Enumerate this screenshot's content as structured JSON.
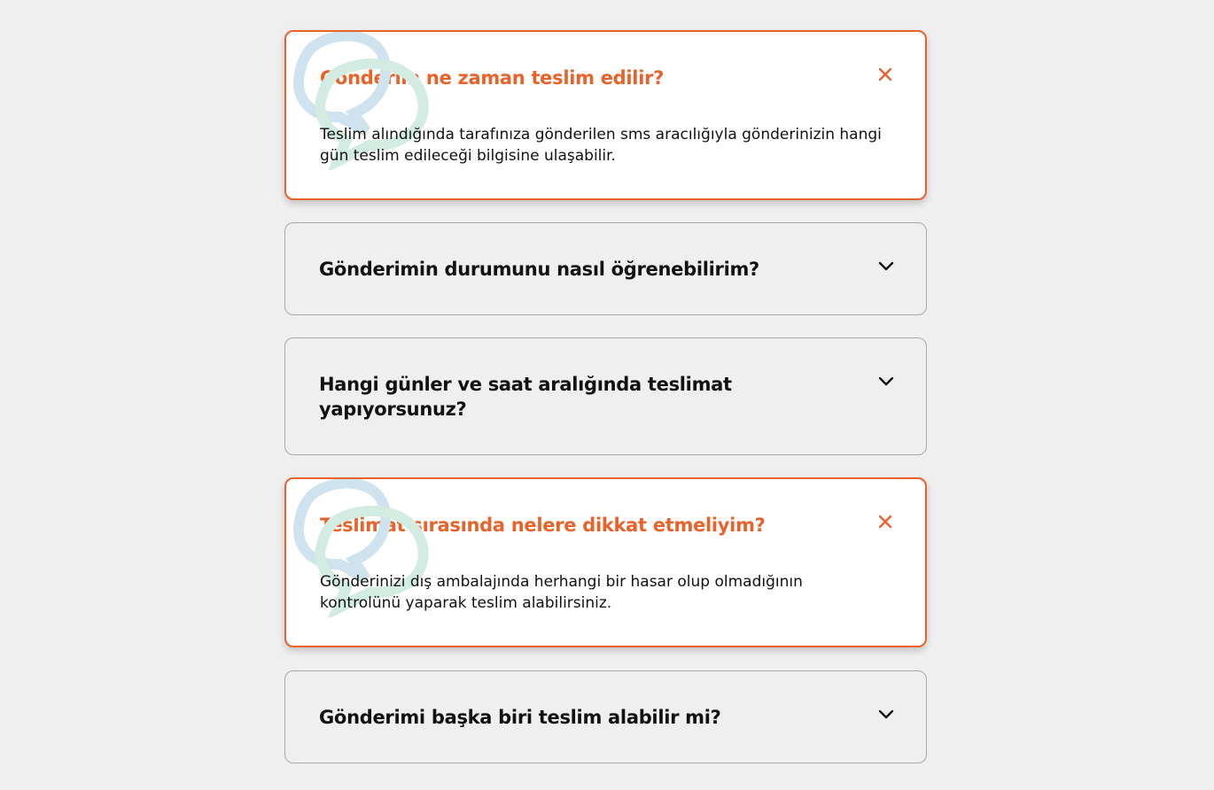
{
  "colors": {
    "accent": "#e8622a",
    "page_background": "#efefef",
    "card_open_background": "#ffffff",
    "card_border": "#a9a9a9",
    "text": "#111111",
    "deco_blue": "#cfe3ef",
    "deco_green": "#d3ece2"
  },
  "faq": {
    "items": [
      {
        "question": "Gönderim ne zaman teslim edilir?",
        "answer": "Teslim alındığında tarafınıza gönderilen sms aracılığıyla gönderinizin hangi gün teslim edileceği bilgisine ulaşabilir.",
        "state": "open",
        "toggle_icon": "close-icon"
      },
      {
        "question": "Gönderimin durumunu nasıl öğrenebilirim?",
        "state": "collapsed",
        "toggle_icon": "chevron-down-icon"
      },
      {
        "question": "Hangi günler ve saat aralığında teslimat yapıyorsunuz?",
        "state": "collapsed",
        "toggle_icon": "chevron-down-icon"
      },
      {
        "question": "Teslimat sırasında nelere dikkat etmeliyim?",
        "answer": "Gönderinizi dış ambalajında herhangi bir hasar olup olmadığının kontrolünü yaparak teslim alabilirsiniz.",
        "state": "open",
        "toggle_icon": "close-icon"
      },
      {
        "question": "Gönderimi başka biri teslim alabilir mi?",
        "state": "collapsed",
        "toggle_icon": "chevron-down-icon"
      }
    ]
  }
}
